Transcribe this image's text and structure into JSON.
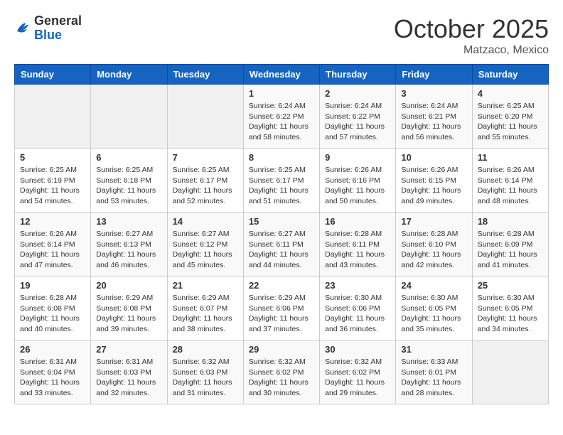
{
  "header": {
    "logo_line1": "General",
    "logo_line2": "Blue",
    "month": "October 2025",
    "location": "Matzaco, Mexico"
  },
  "days_of_week": [
    "Sunday",
    "Monday",
    "Tuesday",
    "Wednesday",
    "Thursday",
    "Friday",
    "Saturday"
  ],
  "weeks": [
    [
      {
        "num": "",
        "sunrise": "",
        "sunset": "",
        "daylight": ""
      },
      {
        "num": "",
        "sunrise": "",
        "sunset": "",
        "daylight": ""
      },
      {
        "num": "",
        "sunrise": "",
        "sunset": "",
        "daylight": ""
      },
      {
        "num": "1",
        "sunrise": "Sunrise: 6:24 AM",
        "sunset": "Sunset: 6:22 PM",
        "daylight": "Daylight: 11 hours and 58 minutes."
      },
      {
        "num": "2",
        "sunrise": "Sunrise: 6:24 AM",
        "sunset": "Sunset: 6:22 PM",
        "daylight": "Daylight: 11 hours and 57 minutes."
      },
      {
        "num": "3",
        "sunrise": "Sunrise: 6:24 AM",
        "sunset": "Sunset: 6:21 PM",
        "daylight": "Daylight: 11 hours and 56 minutes."
      },
      {
        "num": "4",
        "sunrise": "Sunrise: 6:25 AM",
        "sunset": "Sunset: 6:20 PM",
        "daylight": "Daylight: 11 hours and 55 minutes."
      }
    ],
    [
      {
        "num": "5",
        "sunrise": "Sunrise: 6:25 AM",
        "sunset": "Sunset: 6:19 PM",
        "daylight": "Daylight: 11 hours and 54 minutes."
      },
      {
        "num": "6",
        "sunrise": "Sunrise: 6:25 AM",
        "sunset": "Sunset: 6:18 PM",
        "daylight": "Daylight: 11 hours and 53 minutes."
      },
      {
        "num": "7",
        "sunrise": "Sunrise: 6:25 AM",
        "sunset": "Sunset: 6:17 PM",
        "daylight": "Daylight: 11 hours and 52 minutes."
      },
      {
        "num": "8",
        "sunrise": "Sunrise: 6:25 AM",
        "sunset": "Sunset: 6:17 PM",
        "daylight": "Daylight: 11 hours and 51 minutes."
      },
      {
        "num": "9",
        "sunrise": "Sunrise: 6:26 AM",
        "sunset": "Sunset: 6:16 PM",
        "daylight": "Daylight: 11 hours and 50 minutes."
      },
      {
        "num": "10",
        "sunrise": "Sunrise: 6:26 AM",
        "sunset": "Sunset: 6:15 PM",
        "daylight": "Daylight: 11 hours and 49 minutes."
      },
      {
        "num": "11",
        "sunrise": "Sunrise: 6:26 AM",
        "sunset": "Sunset: 6:14 PM",
        "daylight": "Daylight: 11 hours and 48 minutes."
      }
    ],
    [
      {
        "num": "12",
        "sunrise": "Sunrise: 6:26 AM",
        "sunset": "Sunset: 6:14 PM",
        "daylight": "Daylight: 11 hours and 47 minutes."
      },
      {
        "num": "13",
        "sunrise": "Sunrise: 6:27 AM",
        "sunset": "Sunset: 6:13 PM",
        "daylight": "Daylight: 11 hours and 46 minutes."
      },
      {
        "num": "14",
        "sunrise": "Sunrise: 6:27 AM",
        "sunset": "Sunset: 6:12 PM",
        "daylight": "Daylight: 11 hours and 45 minutes."
      },
      {
        "num": "15",
        "sunrise": "Sunrise: 6:27 AM",
        "sunset": "Sunset: 6:11 PM",
        "daylight": "Daylight: 11 hours and 44 minutes."
      },
      {
        "num": "16",
        "sunrise": "Sunrise: 6:28 AM",
        "sunset": "Sunset: 6:11 PM",
        "daylight": "Daylight: 11 hours and 43 minutes."
      },
      {
        "num": "17",
        "sunrise": "Sunrise: 6:28 AM",
        "sunset": "Sunset: 6:10 PM",
        "daylight": "Daylight: 11 hours and 42 minutes."
      },
      {
        "num": "18",
        "sunrise": "Sunrise: 6:28 AM",
        "sunset": "Sunset: 6:09 PM",
        "daylight": "Daylight: 11 hours and 41 minutes."
      }
    ],
    [
      {
        "num": "19",
        "sunrise": "Sunrise: 6:28 AM",
        "sunset": "Sunset: 6:08 PM",
        "daylight": "Daylight: 11 hours and 40 minutes."
      },
      {
        "num": "20",
        "sunrise": "Sunrise: 6:29 AM",
        "sunset": "Sunset: 6:08 PM",
        "daylight": "Daylight: 11 hours and 39 minutes."
      },
      {
        "num": "21",
        "sunrise": "Sunrise: 6:29 AM",
        "sunset": "Sunset: 6:07 PM",
        "daylight": "Daylight: 11 hours and 38 minutes."
      },
      {
        "num": "22",
        "sunrise": "Sunrise: 6:29 AM",
        "sunset": "Sunset: 6:06 PM",
        "daylight": "Daylight: 11 hours and 37 minutes."
      },
      {
        "num": "23",
        "sunrise": "Sunrise: 6:30 AM",
        "sunset": "Sunset: 6:06 PM",
        "daylight": "Daylight: 11 hours and 36 minutes."
      },
      {
        "num": "24",
        "sunrise": "Sunrise: 6:30 AM",
        "sunset": "Sunset: 6:05 PM",
        "daylight": "Daylight: 11 hours and 35 minutes."
      },
      {
        "num": "25",
        "sunrise": "Sunrise: 6:30 AM",
        "sunset": "Sunset: 6:05 PM",
        "daylight": "Daylight: 11 hours and 34 minutes."
      }
    ],
    [
      {
        "num": "26",
        "sunrise": "Sunrise: 6:31 AM",
        "sunset": "Sunset: 6:04 PM",
        "daylight": "Daylight: 11 hours and 33 minutes."
      },
      {
        "num": "27",
        "sunrise": "Sunrise: 6:31 AM",
        "sunset": "Sunset: 6:03 PM",
        "daylight": "Daylight: 11 hours and 32 minutes."
      },
      {
        "num": "28",
        "sunrise": "Sunrise: 6:32 AM",
        "sunset": "Sunset: 6:03 PM",
        "daylight": "Daylight: 11 hours and 31 minutes."
      },
      {
        "num": "29",
        "sunrise": "Sunrise: 6:32 AM",
        "sunset": "Sunset: 6:02 PM",
        "daylight": "Daylight: 11 hours and 30 minutes."
      },
      {
        "num": "30",
        "sunrise": "Sunrise: 6:32 AM",
        "sunset": "Sunset: 6:02 PM",
        "daylight": "Daylight: 11 hours and 29 minutes."
      },
      {
        "num": "31",
        "sunrise": "Sunrise: 6:33 AM",
        "sunset": "Sunset: 6:01 PM",
        "daylight": "Daylight: 11 hours and 28 minutes."
      },
      {
        "num": "",
        "sunrise": "",
        "sunset": "",
        "daylight": ""
      }
    ]
  ]
}
